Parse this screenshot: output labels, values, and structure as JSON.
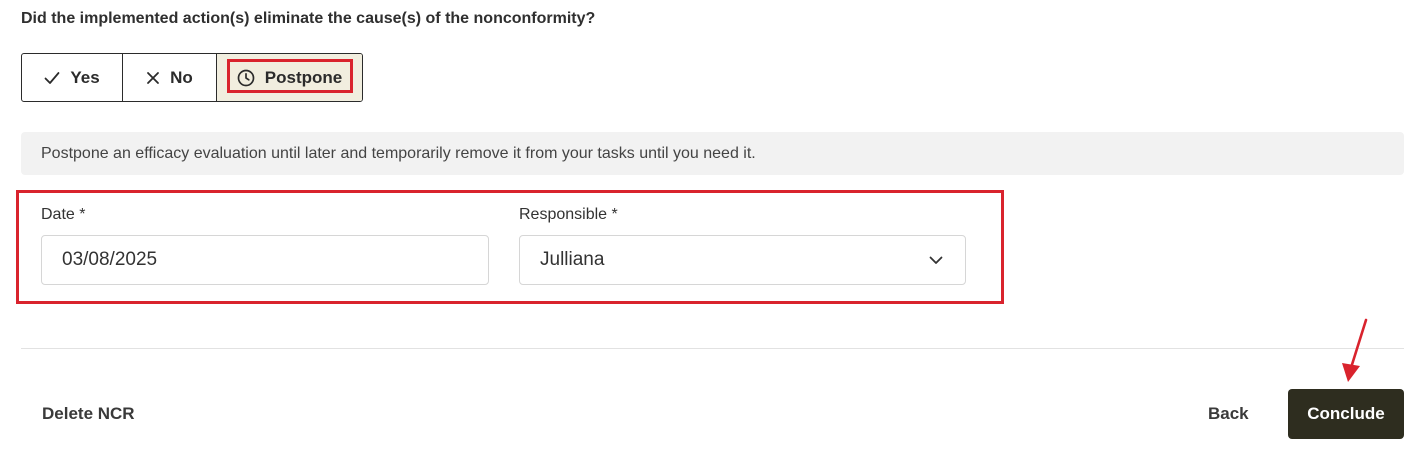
{
  "question": "Did the implemented action(s) eliminate the cause(s) of the nonconformity?",
  "options": {
    "yes_label": "Yes",
    "no_label": "No",
    "postpone_label": "Postpone",
    "selected": "Postpone"
  },
  "info_text": "Postpone an efficacy evaluation until later and temporarily remove it from your tasks until you need it.",
  "date_field": {
    "label": "Date *",
    "value": "03/08/2025"
  },
  "responsible_field": {
    "label": "Responsible *",
    "value": "Julliana"
  },
  "footer": {
    "delete_label": "Delete NCR",
    "back_label": "Back",
    "conclude_label": "Conclude"
  },
  "colors": {
    "accent_dark": "#2e2d1f",
    "selected_bg": "#f1eedf",
    "annotation_red": "#d9232d"
  },
  "icons": {
    "yes": "check-icon",
    "no": "x-icon",
    "postpone": "clock-icon",
    "dropdown": "chevron-down-icon"
  }
}
